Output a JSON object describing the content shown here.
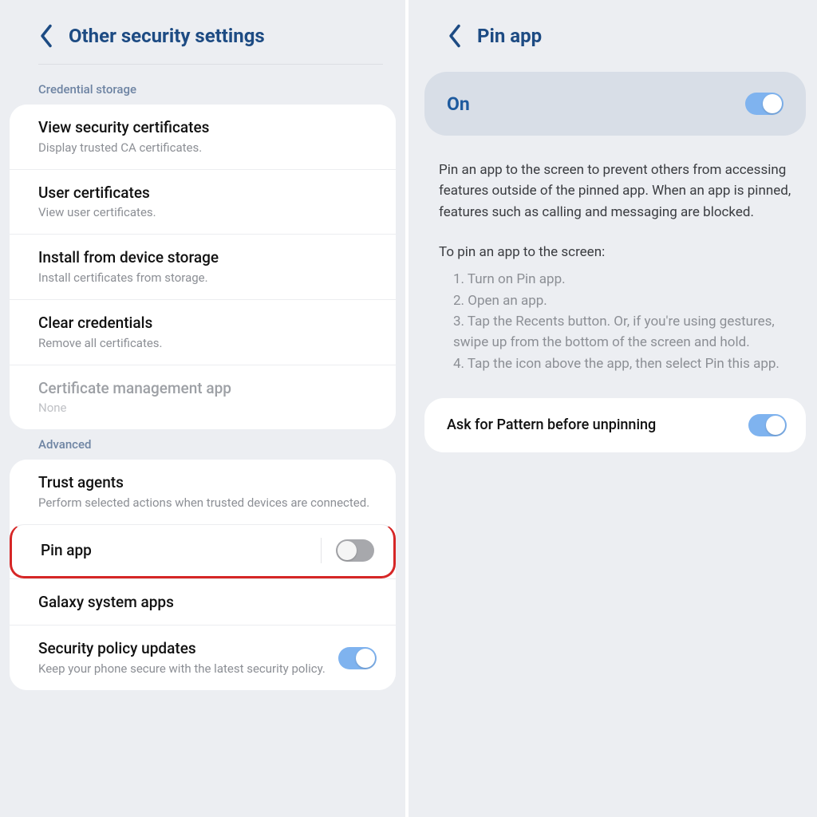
{
  "left": {
    "title": "Other security settings",
    "section1": "Credential storage",
    "rows1": {
      "view_cert": {
        "title": "View security certificates",
        "sub": "Display trusted CA certificates."
      },
      "user_cert": {
        "title": "User certificates",
        "sub": "View user certificates."
      },
      "install": {
        "title": "Install from device storage",
        "sub": "Install certificates from storage."
      },
      "clear": {
        "title": "Clear credentials",
        "sub": "Remove all certificates."
      },
      "mgmt": {
        "title": "Certificate management app",
        "sub": "None"
      }
    },
    "section2": "Advanced",
    "rows2": {
      "trust": {
        "title": "Trust agents",
        "sub": "Perform selected actions when trusted devices are connected."
      },
      "pinapp": {
        "title": "Pin app"
      },
      "galaxy": {
        "title": "Galaxy system apps"
      },
      "policy": {
        "title": "Security policy updates",
        "sub": "Keep your phone secure with the latest security policy."
      }
    }
  },
  "right": {
    "title": "Pin app",
    "on_label": "On",
    "description": "Pin an app to the screen to prevent others from accessing features outside of the pinned app. When an app is pinned, features such as calling and messaging are blocked.",
    "steps_title": "To pin an app to the screen:",
    "steps": {
      "s1": "1. Turn on Pin app.",
      "s2": "2. Open an app.",
      "s3": "3. Tap the Recents button. Or, if you're using gestures, swipe up from the bottom of the screen and hold.",
      "s4": "4. Tap the icon above the app, then select Pin this app."
    },
    "ask_pattern": "Ask for Pattern before unpinning"
  }
}
